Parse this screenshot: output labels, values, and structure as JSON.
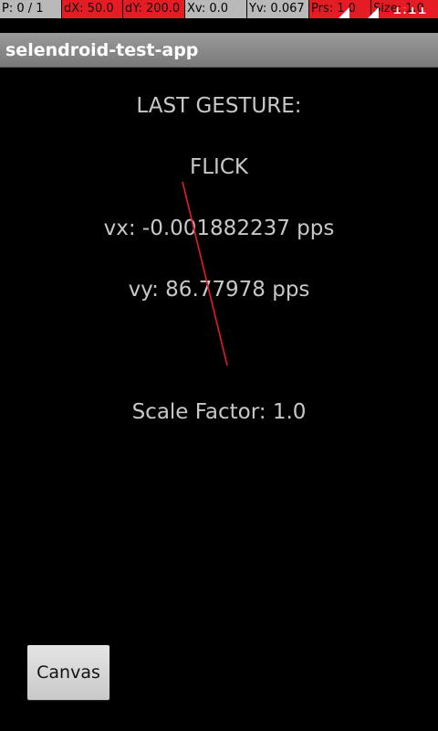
{
  "pointer_location": {
    "p": "P: 0 / 1",
    "dx": "dX: 50.0",
    "dy": "dY: 200.0",
    "xv": "Xv: 0.0",
    "yv": "Yv: 0.067",
    "prs": "Prs: 1.0",
    "size": "Size: 1.0",
    "clock": "1:11"
  },
  "action_bar": {
    "title": "selendroid-test-app"
  },
  "gesture_info": {
    "heading": "LAST GESTURE:",
    "type": "FLICK",
    "vx": "vx: -0.001882237 pps",
    "vy": "vy: 86.77978 pps",
    "scale": "Scale Factor: 1.0"
  },
  "canvas_button": {
    "label": "Canvas"
  },
  "colors": {
    "trail": "#e51c23",
    "text": "#c8c8c8",
    "background": "#000000"
  }
}
